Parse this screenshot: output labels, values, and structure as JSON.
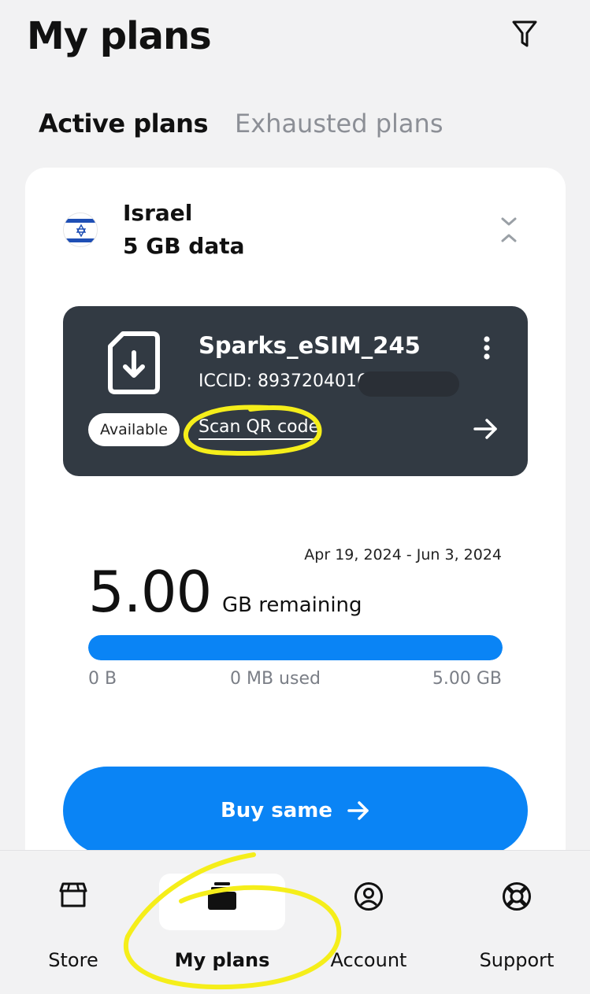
{
  "header": {
    "title": "My plans",
    "filter_icon": "filter-icon"
  },
  "tabs": [
    {
      "label": "Active plans",
      "active": true
    },
    {
      "label": "Exhausted plans",
      "active": false
    }
  ],
  "plan": {
    "country": "Israel",
    "data_amount": "5 GB data",
    "flag_icon": "israel-flag-icon"
  },
  "esim": {
    "name": "Sparks_eSIM_245",
    "iccid": "ICCID: 8937204016",
    "status": "Available",
    "scan_label": "Scan QR code"
  },
  "usage": {
    "date_range": "Apr 19, 2024 - Jun 3, 2024",
    "remaining_value": "5.00",
    "remaining_unit": "GB remaining",
    "min_label": "0 B",
    "used_label": "0 MB used",
    "max_label": "5.00 GB",
    "remaining_fraction": 1.0
  },
  "actions": {
    "buy_same": "Buy same"
  },
  "bottom_nav": [
    {
      "label": "Store",
      "icon": "store-icon",
      "active": false
    },
    {
      "label": "My plans",
      "icon": "sim-stack-icon",
      "active": true
    },
    {
      "label": "Account",
      "icon": "account-icon",
      "active": false
    },
    {
      "label": "Support",
      "icon": "lifebuoy-icon",
      "active": false
    }
  ],
  "colors": {
    "accent": "#0a84f5",
    "esim_card_bg": "#323a43",
    "page_bg": "#f2f2f3",
    "annotation": "#f5ee1a"
  }
}
